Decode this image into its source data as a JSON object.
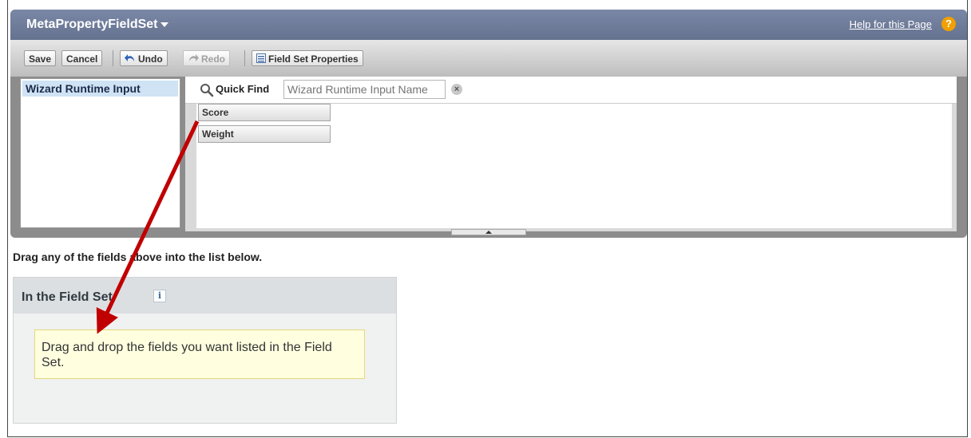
{
  "header": {
    "title": "MetaPropertyFieldSet",
    "help_label": "Help for this Page",
    "help_icon": "?"
  },
  "toolbar": {
    "save_label": "Save",
    "cancel_label": "Cancel",
    "undo_label": "Undo",
    "redo_label": "Redo",
    "field_set_properties_label": "Field Set Properties"
  },
  "sidebar": {
    "items": [
      {
        "label": "Wizard Runtime Input"
      }
    ]
  },
  "quick_find": {
    "label": "Quick Find",
    "placeholder": "Wizard Runtime Input Name"
  },
  "fields": [
    {
      "label": "Score"
    },
    {
      "label": "Weight"
    }
  ],
  "instruction": "Drag any of the fields above into the list below.",
  "field_set": {
    "title": "In the Field Set",
    "info_icon": "i",
    "drop_hint": "Drag and drop the fields you want listed in the Field Set."
  },
  "colors": {
    "header_blue": "#6f7c9a",
    "selected_item": "#cfe3f5",
    "drop_zone": "#ffffe0",
    "annotation_arrow": "#c00000"
  }
}
